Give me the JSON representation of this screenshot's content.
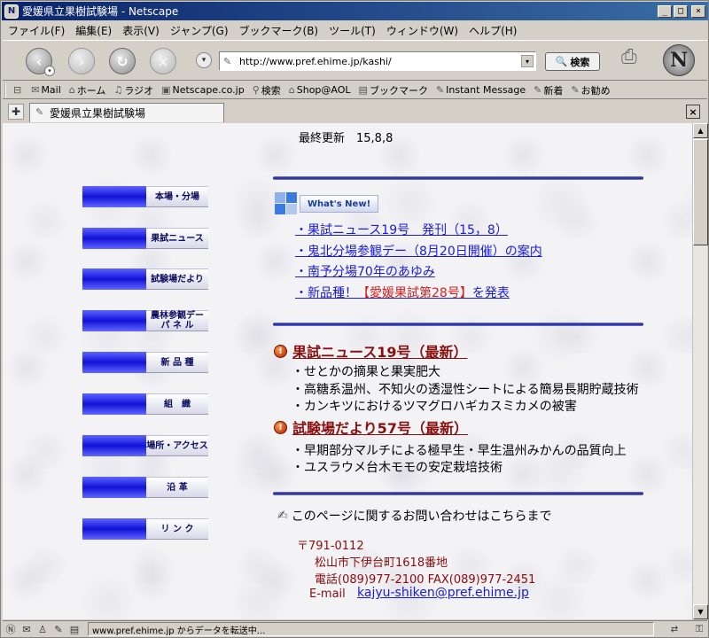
{
  "window": {
    "title": "愛媛県立果樹試験場 - Netscape"
  },
  "menu": [
    "ファイル(F)",
    "編集(E)",
    "表示(V)",
    "ジャンプ(G)",
    "ブックマーク(B)",
    "ツール(T)",
    "ウィンドウ(W)",
    "ヘルプ(H)"
  ],
  "toolbar": {
    "url": "http://www.pref.ehime.jp/kashi/",
    "search_label": "検索"
  },
  "personal_toolbar": [
    "Mail",
    "ホーム",
    "ラジオ",
    "Netscape.co.jp",
    "検索",
    "Shop@AOL",
    "ブックマーク",
    "Instant Message",
    "新着",
    "お勧め"
  ],
  "tab": {
    "title": "愛媛県立果樹試験場"
  },
  "page": {
    "last_updated": "最終更新　15,8,8",
    "nav": [
      "本場・分場",
      "果試ニュース",
      "試験場だより",
      "農林参観デー\nパ ネ ル",
      "新 品 種",
      "組　織",
      "場所・アクセス",
      "沿 革",
      "リ ン ク"
    ],
    "whats_new_label": "What's New!",
    "news": [
      {
        "text": "・果試ニュース19号　発刊（15，8）"
      },
      {
        "text": "・鬼北分場参観デー（8月20日開催）の案内"
      },
      {
        "text": "・南予分場70年のあゆみ"
      },
      {
        "prefix": "・新品種！",
        "highlight": "【愛媛果試第28号】",
        "suffix": "を発表"
      }
    ],
    "section1": {
      "title": "果試ニュース19号（最新）",
      "items": [
        "・せとかの摘果と果実肥大",
        "・高糖系温州、不知火の透湿性シートによる簡易長期貯蔵技術",
        "・カンキツにおけるツマグロハギカスミカメの被害"
      ]
    },
    "section2": {
      "title": "試験場だより57号（最新）",
      "items": [
        "・早期部分マルチによる極早生・早生温州みかんの品質向上",
        "・ユスラウメ台木モモの安定栽培技術"
      ]
    },
    "contact": {
      "heading": "このページに関するお問い合わせはこちらまで",
      "postal": "〒791-0112",
      "address": "松山市下伊台町1618番地",
      "phone": "電話(089)977-2100 FAX(089)977-2451",
      "email_label": "E-mail",
      "email": "kajyu-shiken@pref.ehime.jp"
    }
  },
  "status": {
    "text": "www.pref.ehime.jp からデータを転送中..."
  }
}
